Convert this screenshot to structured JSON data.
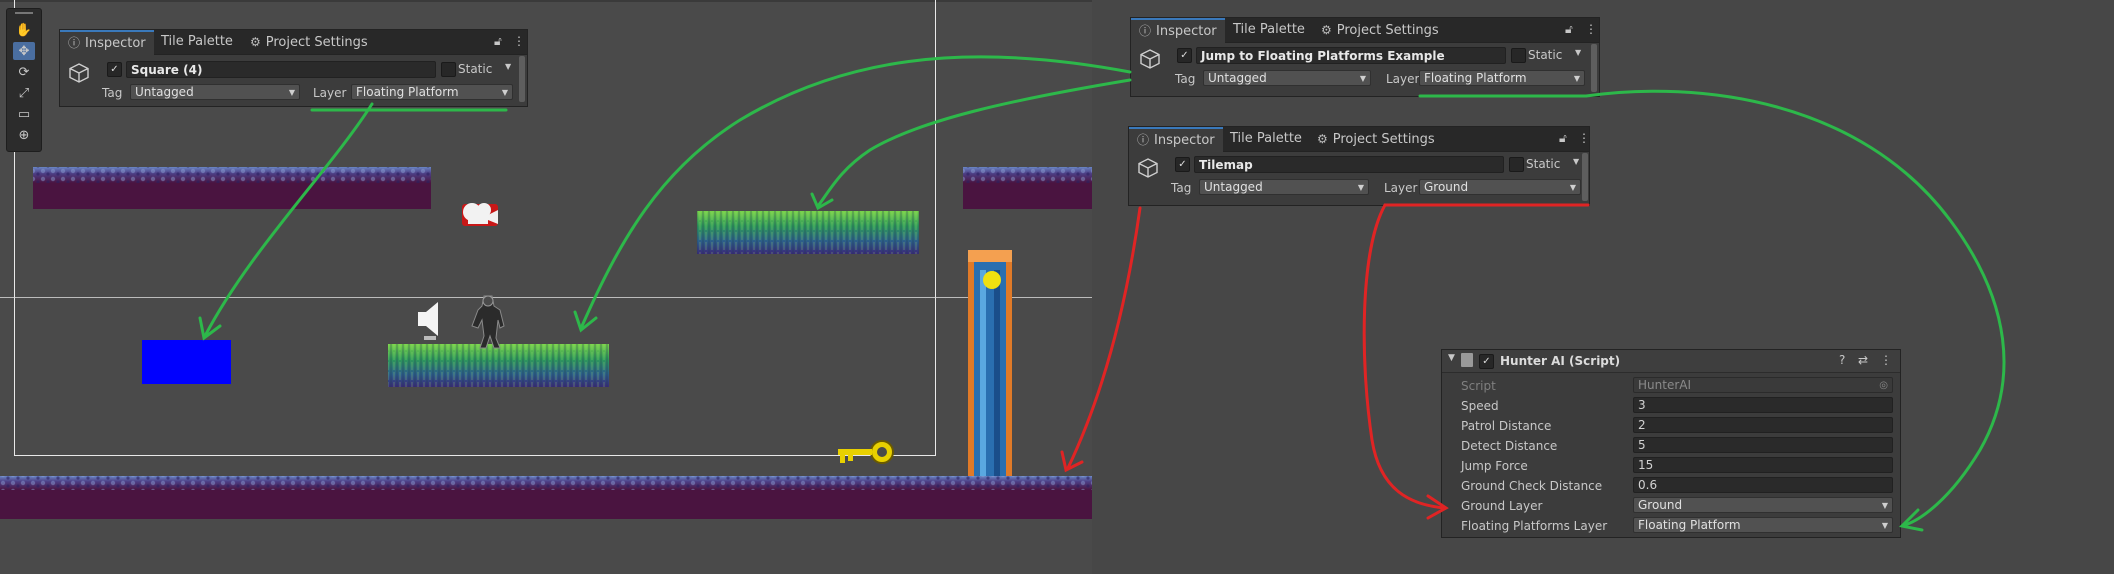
{
  "scene_view": {
    "tools": [
      "hand-tool",
      "move-tool",
      "rotate-tool",
      "scale-tool",
      "rect-tool",
      "transform-tool"
    ]
  },
  "inspector_square": {
    "tabs": [
      "Inspector",
      "Tile Palette",
      "Project Settings"
    ],
    "object_name": "Square (4)",
    "static_label": "Static",
    "tag_label": "Tag",
    "tag_value": "Untagged",
    "layer_label": "Layer",
    "layer_value": "Floating Platform"
  },
  "inspector_jump": {
    "tabs": [
      "Inspector",
      "Tile Palette",
      "Project Settings"
    ],
    "object_name": "Jump to Floating Platforms Example",
    "static_label": "Static",
    "tag_label": "Tag",
    "tag_value": "Untagged",
    "layer_label": "Layer",
    "layer_value": "Floating Platform"
  },
  "inspector_tilemap": {
    "tabs": [
      "Inspector",
      "Tile Palette",
      "Project Settings"
    ],
    "object_name": "Tilemap",
    "static_label": "Static",
    "tag_label": "Tag",
    "tag_value": "Untagged",
    "layer_label": "Layer",
    "layer_value": "Ground"
  },
  "hunter_ai": {
    "title": "Hunter AI (Script)",
    "script_label": "Script",
    "script_value": "HunterAI",
    "fields": [
      {
        "label": "Speed",
        "value": "3"
      },
      {
        "label": "Patrol Distance",
        "value": "2"
      },
      {
        "label": "Detect Distance",
        "value": "5"
      },
      {
        "label": "Jump Force",
        "value": "15"
      },
      {
        "label": "Ground Check Distance",
        "value": "0.6"
      }
    ],
    "ground_layer_label": "Ground Layer",
    "ground_layer_value": "Ground",
    "floating_layer_label": "Floating Platforms Layer",
    "floating_layer_value": "Floating Platform"
  },
  "colors": {
    "green_arrow": "#2db84a",
    "red_arrow": "#e02424",
    "platform_green": "#3aa54a",
    "platform_purple": "#4a1440",
    "blue_square": "#0000ff",
    "key_yellow": "#e8d000"
  }
}
